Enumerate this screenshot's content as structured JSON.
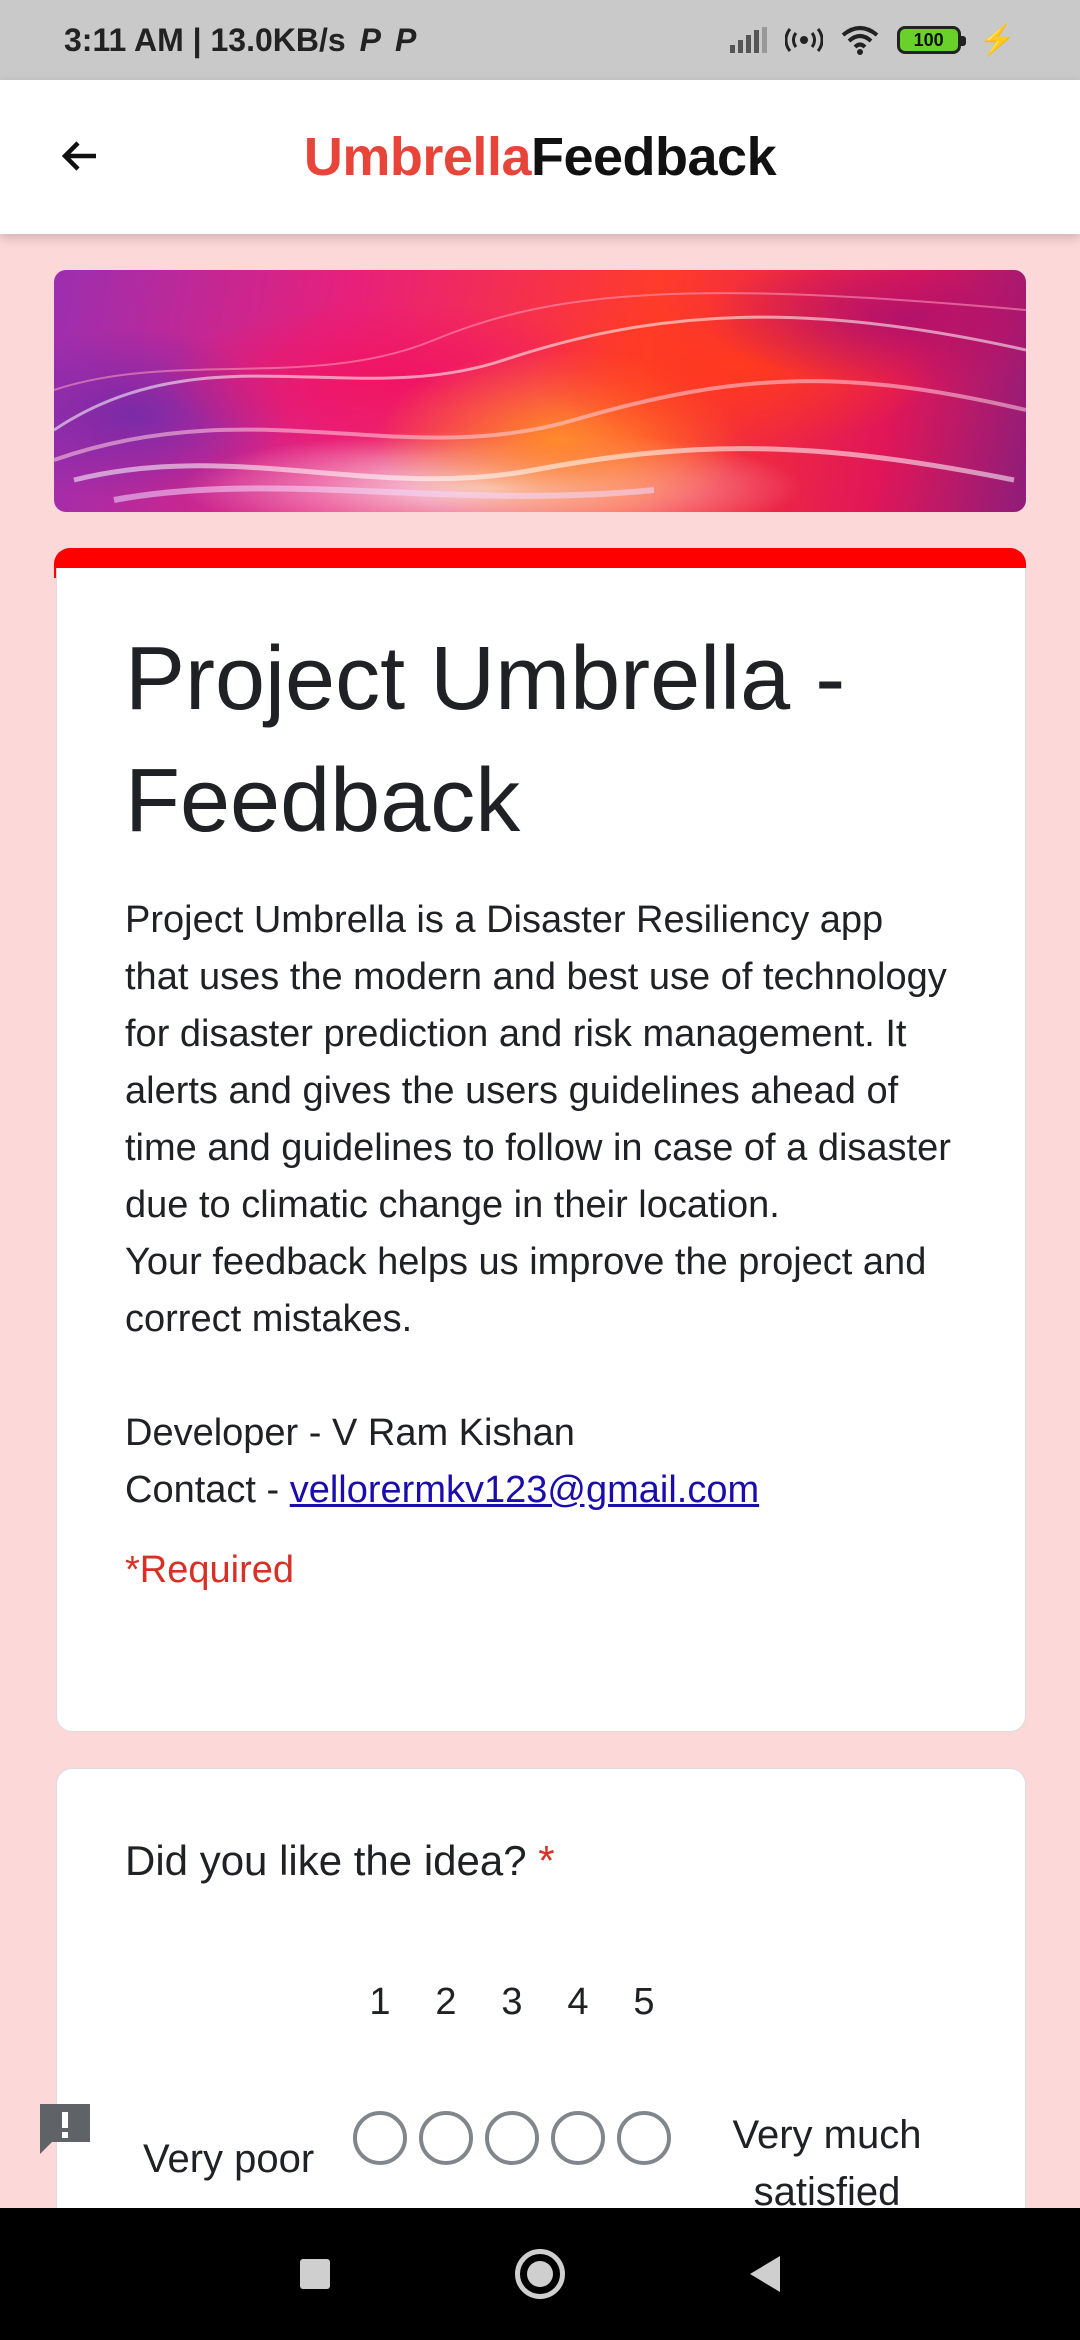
{
  "status_bar": {
    "time_speed": "3:11 AM | 13.0KB/s",
    "notif_icons": [
      "P",
      "P"
    ],
    "battery": "100"
  },
  "app_bar": {
    "title_part1": "Umbrella",
    "title_part2": "Feedback",
    "title_part1_color": "#e8443a"
  },
  "form": {
    "title": "Project Umbrella - Feedback",
    "description": [
      "Project Umbrella is a Disaster Resiliency app that uses the modern and best use of technology for disaster prediction and risk management. It alerts and gives the users guidelines ahead of time and guidelines to follow in case of a disaster due to climatic change in their location.",
      "Your feedback helps us improve the project and correct mistakes."
    ],
    "developer": "Developer - V Ram Kishan",
    "contact_prefix": "Contact - ",
    "contact_email": "vellorermkv123@gmail.com",
    "required_note": "*Required",
    "accent_color": "#ff0000"
  },
  "question1": {
    "title": "Did you like the idea?",
    "required_mark": "*",
    "scale": [
      "1",
      "2",
      "3",
      "4",
      "5"
    ],
    "label_low": "Very poor",
    "label_high": "Very much satisfied"
  }
}
